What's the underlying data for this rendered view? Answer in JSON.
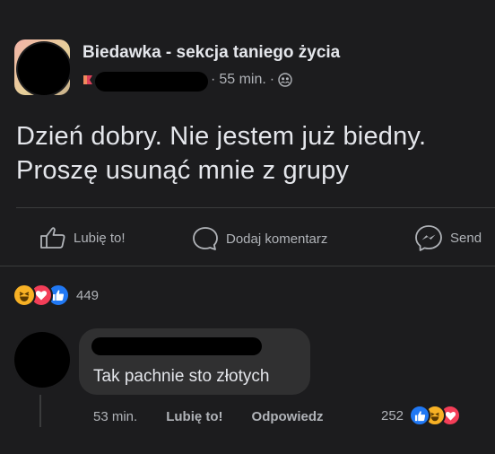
{
  "post": {
    "group_name": "Biedawka - sekcja taniego życia",
    "time": "55 min.",
    "separator": "·",
    "text_line1": "Dzień dobry. Nie jestem już biedny.",
    "text_line2": "Proszę usunąć mnie z grupy",
    "audience_icon": "friends-icon"
  },
  "actions": {
    "like": "Lubię to!",
    "comment": "Dodaj komentarz",
    "send": "Send"
  },
  "reactions": {
    "icons": [
      "haha",
      "love",
      "like"
    ],
    "count": "449"
  },
  "comment": {
    "text": "Tak pachnie sto złotych",
    "time": "53 min.",
    "like": "Lubię to!",
    "reply": "Odpowiedz",
    "reaction_count": "252",
    "reaction_icons": [
      "like",
      "haha",
      "love"
    ]
  },
  "colors": {
    "background": "#1c1c1e",
    "text": "#e4e6eb",
    "muted": "#b0b3b8",
    "bubble": "#303031",
    "like_blue": "#2078f4",
    "love_red": "#f33e58",
    "haha_yellow": "#f7b125"
  }
}
